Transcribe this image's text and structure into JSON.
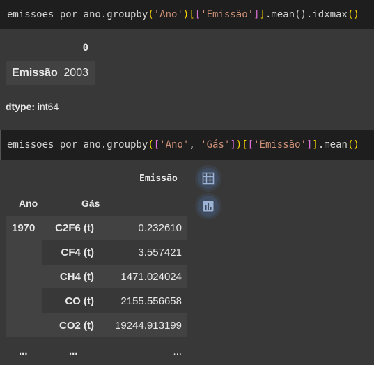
{
  "cell1": {
    "code_prefix": "emissoes_por_ano.groupby",
    "arg": "'Ano'",
    "col": "'Emissão'",
    "code_suffix": ".mean().idxmax"
  },
  "output1": {
    "column_header": "0",
    "row_label": "Emissão",
    "row_value": "2003",
    "dtype_label": "dtype:",
    "dtype_value": "int64"
  },
  "cell2": {
    "code_prefix": "emissoes_por_ano.groupby",
    "arg1": "'Ano'",
    "arg2": "'Gás'",
    "col": "'Emissão'",
    "code_suffix": ".mean"
  },
  "output2": {
    "column_header": "Emissão",
    "index_headers": {
      "ano": "Ano",
      "gas": "Gás"
    },
    "rows": [
      {
        "ano": "1970",
        "gas": "C2F6 (t)",
        "value": "0.232610"
      },
      {
        "ano": "",
        "gas": "CF4 (t)",
        "value": "3.557421"
      },
      {
        "ano": "",
        "gas": "CH4 (t)",
        "value": "1471.024024"
      },
      {
        "ano": "",
        "gas": "CO (t)",
        "value": "2155.556658"
      },
      {
        "ano": "",
        "gas": "CO2 (t)",
        "value": "19244.913199"
      },
      {
        "ano": "...",
        "gas": "...",
        "value": "..."
      }
    ],
    "buttons": {
      "table": "table-icon",
      "chart": "bar-chart-icon"
    }
  }
}
